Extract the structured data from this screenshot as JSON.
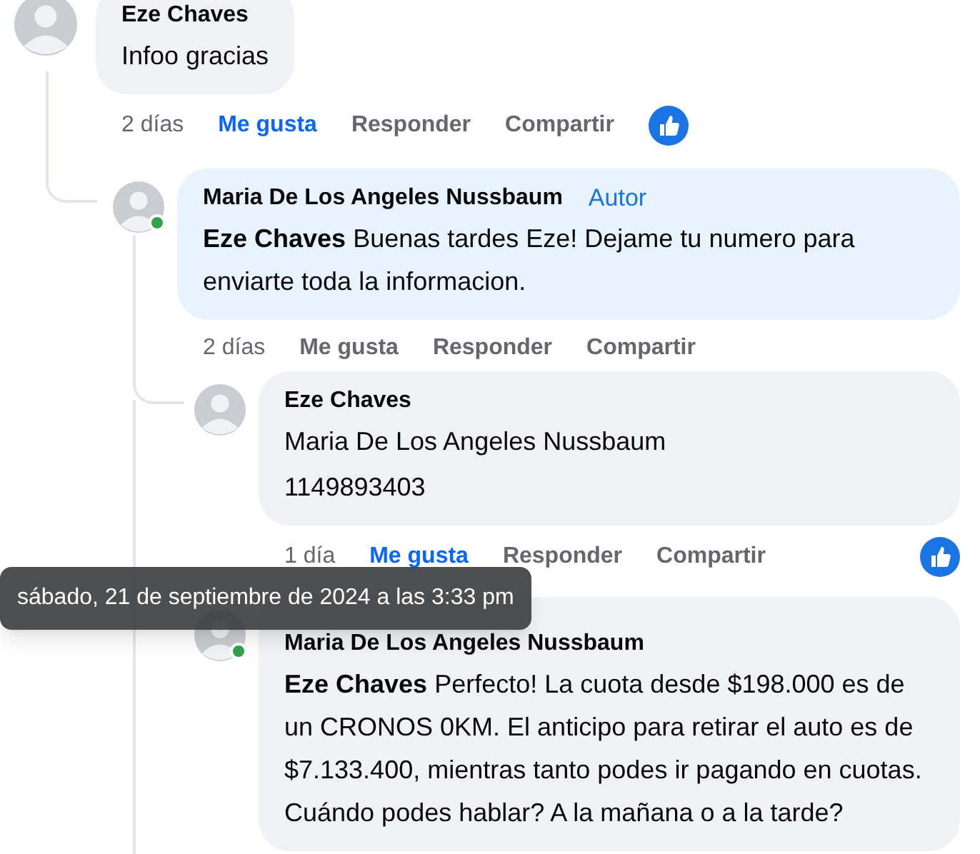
{
  "comments": [
    {
      "author": "Eze Chaves",
      "is_author": false,
      "online": false,
      "body": [
        "Infoo gracias"
      ],
      "time": "2 días",
      "actions": {
        "like": "Me gusta",
        "reply": "Responder",
        "share": "Compartir"
      },
      "liked": true,
      "has_reactions": true
    },
    {
      "author": "Maria De Los Angeles Nussbaum",
      "is_author": true,
      "badge": "Autor",
      "online": true,
      "body": [
        "**Eze Chaves** Buenas tardes Eze! Dejame tu numero para enviarte toda la informacion."
      ],
      "time": "2 días",
      "actions": {
        "like": "Me gusta",
        "reply": "Responder",
        "share": "Compartir"
      },
      "liked": false,
      "has_reactions": false
    },
    {
      "author": "Eze Chaves",
      "is_author": false,
      "online": false,
      "body": [
        "Maria De Los Angeles Nussbaum",
        "1149893403"
      ],
      "time": "1 día",
      "actions": {
        "like": "Me gusta",
        "reply": "Responder",
        "share": "Compartir"
      },
      "liked": true,
      "has_reactions": true
    },
    {
      "author": "Maria De Los Angeles Nussbaum",
      "is_author": false,
      "online": true,
      "body": [
        "**Eze Chaves** Perfecto! La cuota desde $198.000 es de un CRONOS 0KM. El anticipo para retirar el auto es de $7.133.400, mientras tanto podes ir pagando en cuotas. Cuándo podes hablar? A la mañana o a la tarde?"
      ]
    }
  ],
  "tooltip": {
    "text": "sábado, 21 de septiembre de 2024 a las 3:33 pm"
  }
}
